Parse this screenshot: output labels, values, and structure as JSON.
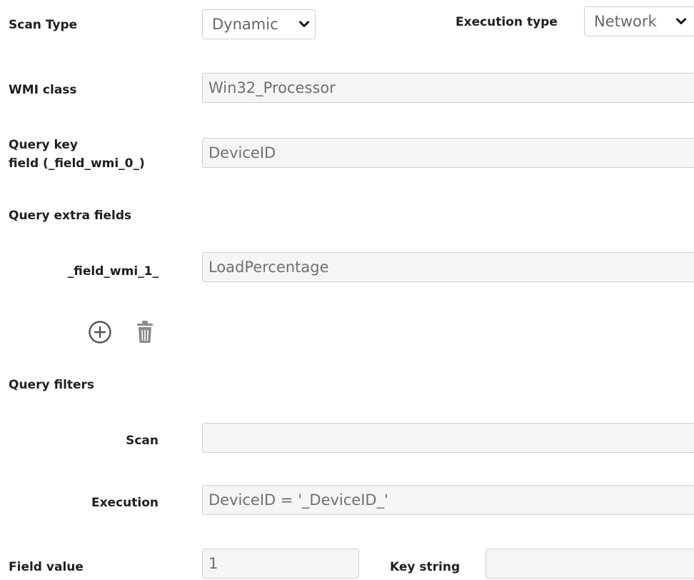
{
  "scan_type": {
    "label": "Scan Type",
    "value": "Dynamic",
    "chevron_icon": "chevron-down-icon"
  },
  "execution_type": {
    "label": "Execution type",
    "value": "Network",
    "chevron_icon": "chevron-down-icon"
  },
  "wmi_class": {
    "label": "WMI class",
    "value": "Win32_Processor"
  },
  "query_key_field": {
    "label_line1": "Query key",
    "label_line2": "field (_field_wmi_0_)",
    "value": "DeviceID"
  },
  "query_extra_fields": {
    "label": "Query extra fields",
    "fields": [
      {
        "label": "_field_wmi_1_",
        "value": "LoadPercentage"
      }
    ],
    "add_icon": "add-circle-icon",
    "delete_icon": "trash-icon"
  },
  "query_filters": {
    "label": "Query filters",
    "scan": {
      "label": "Scan",
      "value": ""
    },
    "execution": {
      "label": "Execution",
      "value": "DeviceID = '_DeviceID_'"
    }
  },
  "field_value": {
    "label": "Field value",
    "value": "1"
  },
  "key_string": {
    "label": "Key string",
    "value": ""
  },
  "colors": {
    "label_text": "#1f1f1f",
    "field_bg": "#f5f5f5",
    "field_border": "#d0d0d0",
    "field_text": "#707070",
    "icon": "#555555"
  }
}
